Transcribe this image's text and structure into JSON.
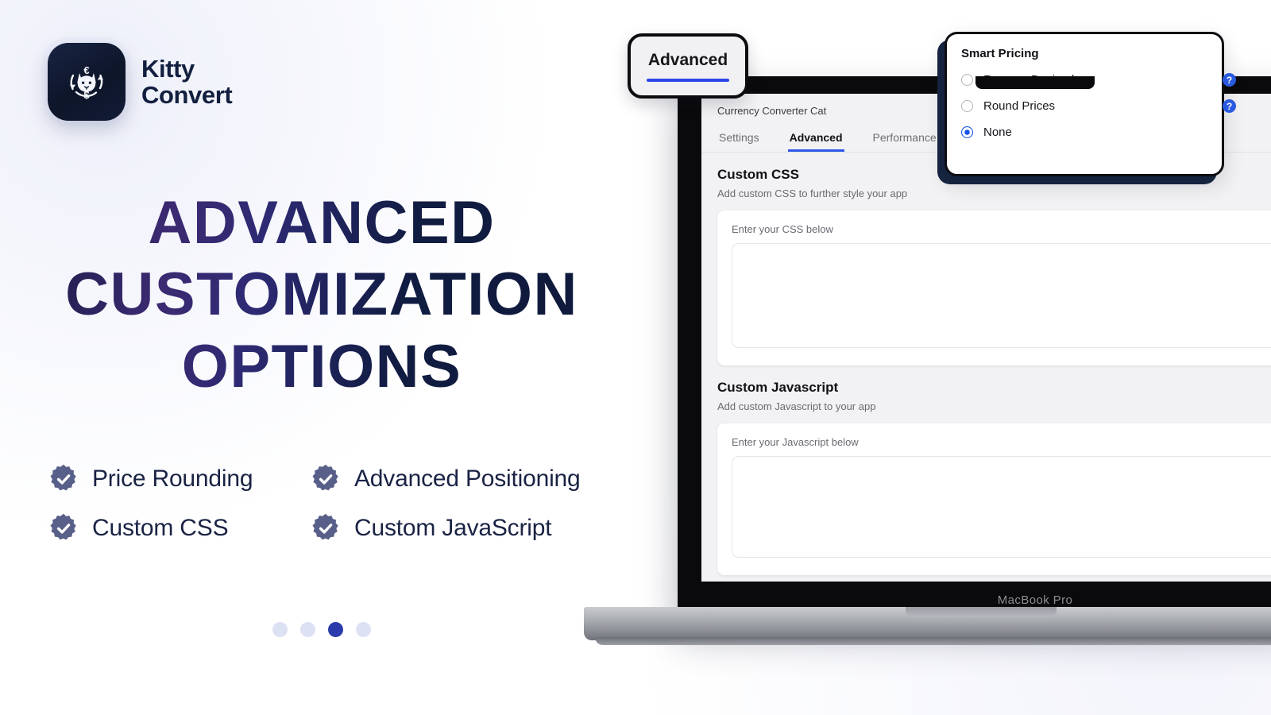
{
  "brand": {
    "name_line1": "Kitty",
    "name_line2": "Convert",
    "logo_icon": "cat-currency-exchange-icon",
    "currency_top": "€",
    "currency_bottom": "$"
  },
  "headline": "ADVANCED CUSTOMIZATION OPTIONS",
  "features": [
    {
      "label": "Price Rounding",
      "icon": "check-badge-icon"
    },
    {
      "label": "Advanced Positioning",
      "icon": "check-badge-icon"
    },
    {
      "label": "Custom CSS",
      "icon": "check-badge-icon"
    },
    {
      "label": "Custom JavaScript",
      "icon": "check-badge-icon"
    }
  ],
  "pagination": {
    "total": 4,
    "active_index": 3
  },
  "callout_tab": {
    "label": "Advanced"
  },
  "callout_panel": {
    "title": "Smart Pricing",
    "options": [
      {
        "label": "Remove Decimals",
        "selected": false,
        "help_icon": "question-mark-icon",
        "help_label": "?"
      },
      {
        "label": "Round Prices",
        "selected": false,
        "help_icon": "question-mark-icon",
        "help_label": "?"
      },
      {
        "label": "None",
        "selected": true,
        "help_icon": "",
        "help_label": ""
      }
    ]
  },
  "device": {
    "model_label": "MacBook Pro"
  },
  "app": {
    "window_title": "Currency Converter Cat",
    "tabs": [
      {
        "label": "Settings",
        "active": false
      },
      {
        "label": "Advanced",
        "active": true
      },
      {
        "label": "Performance",
        "active": false
      }
    ],
    "sections": [
      {
        "title": "Custom CSS",
        "subtitle": "Add custom CSS to further style your app",
        "field_label": "Enter your CSS below",
        "field_value": ""
      },
      {
        "title": "Custom Javascript",
        "subtitle": "Add custom Javascript to your app",
        "field_label": "Enter your Javascript below",
        "field_value": ""
      }
    ]
  },
  "colors": {
    "brand_navy": "#0d1529",
    "headline_gradient_from": "#101a3c",
    "headline_gradient_mid": "#3c2a72",
    "accent_blue": "#2e58e8",
    "radio_blue": "#1a52e8",
    "badge_slate": "#586089",
    "dot_active": "#2b3bab",
    "dot_inactive": "#dde1f4",
    "panel_shadow_navy": "#16233f"
  }
}
